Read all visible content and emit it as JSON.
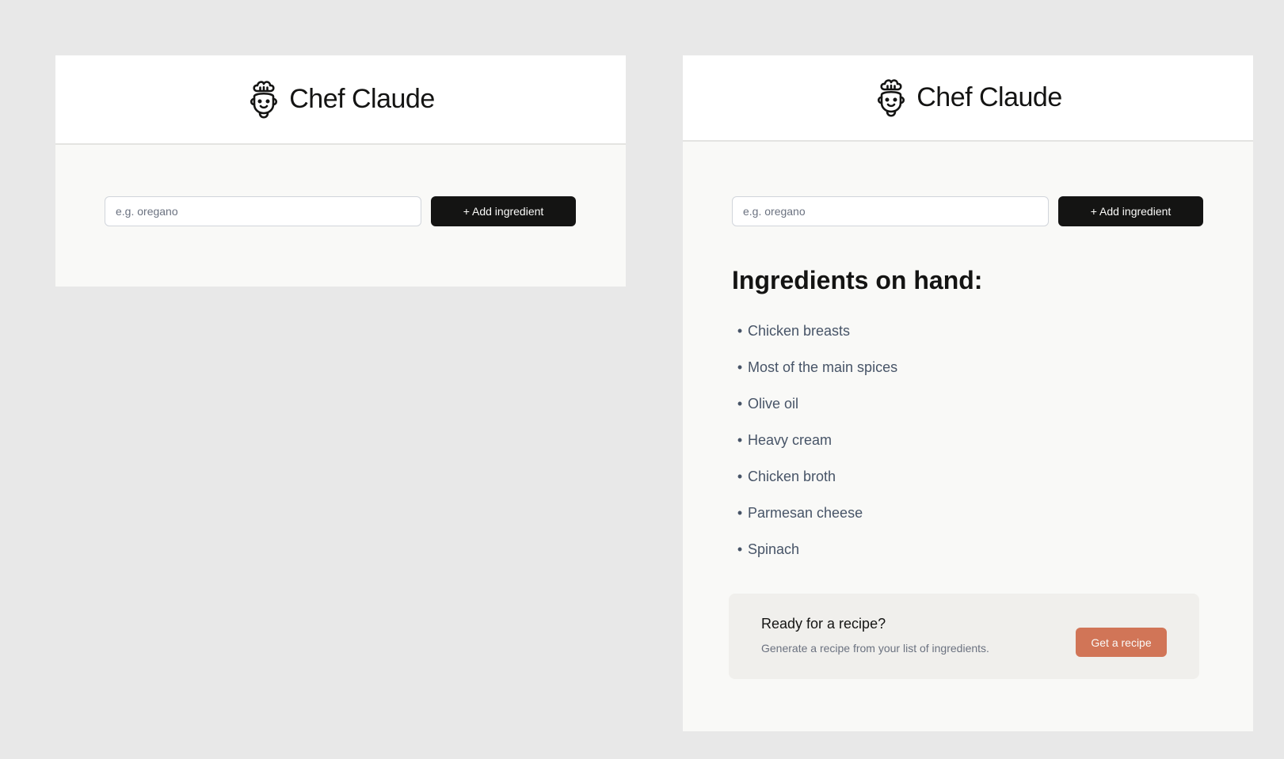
{
  "app": {
    "title": "Chef Claude",
    "logo_icon": "chef-face-icon"
  },
  "form": {
    "input_placeholder": "e.g. oregano",
    "input_value": "",
    "add_button_label": "+ Add ingredient"
  },
  "ingredients": {
    "title": "Ingredients on hand:",
    "items": [
      "Chicken breasts",
      "Most of the main spices",
      "Olive oil",
      "Heavy cream",
      "Chicken broth",
      "Parmesan cheese",
      "Spinach"
    ]
  },
  "recipe_cta": {
    "title": "Ready for a recipe?",
    "description": "Generate a recipe from your list of ingredients.",
    "button_label": "Get a recipe"
  },
  "colors": {
    "page_background": "#e8e8e8",
    "panel_background": "#f9f9f7",
    "primary_button": "#141413",
    "accent_button": "#d17557",
    "cta_card_background": "#f0efec"
  }
}
